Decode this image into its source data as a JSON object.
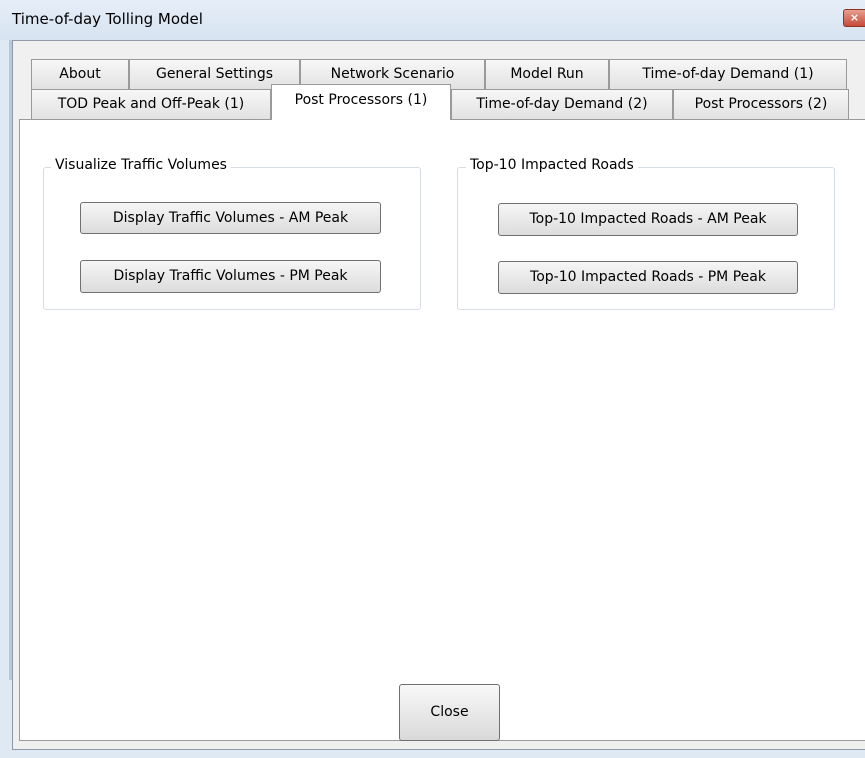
{
  "window": {
    "title": "Time-of-day Tolling Model",
    "close_glyph": "×",
    "close_icon": "close-icon"
  },
  "tabs": {
    "row1": [
      {
        "label": "About"
      },
      {
        "label": "General Settings"
      },
      {
        "label": "Network Scenario"
      },
      {
        "label": "Model Run"
      },
      {
        "label": "Time-of-day Demand (1)"
      }
    ],
    "row2": [
      {
        "label": "TOD Peak and Off-Peak (1)"
      },
      {
        "label": "Post Processors (1)",
        "active": true
      },
      {
        "label": "Time-of-day Demand (2)"
      },
      {
        "label": "Post Processors (2)"
      }
    ]
  },
  "groups": {
    "visualize": {
      "title": "Visualize Traffic Volumes",
      "am_button": "Display Traffic Volumes - AM Peak",
      "pm_button": "Display Traffic Volumes - PM Peak"
    },
    "top10": {
      "title": "Top-10 Impacted Roads",
      "am_button": "Top-10 Impacted Roads - AM Peak",
      "pm_button": "Top-10 Impacted Roads - PM Peak"
    }
  },
  "footer": {
    "close_label": "Close"
  }
}
